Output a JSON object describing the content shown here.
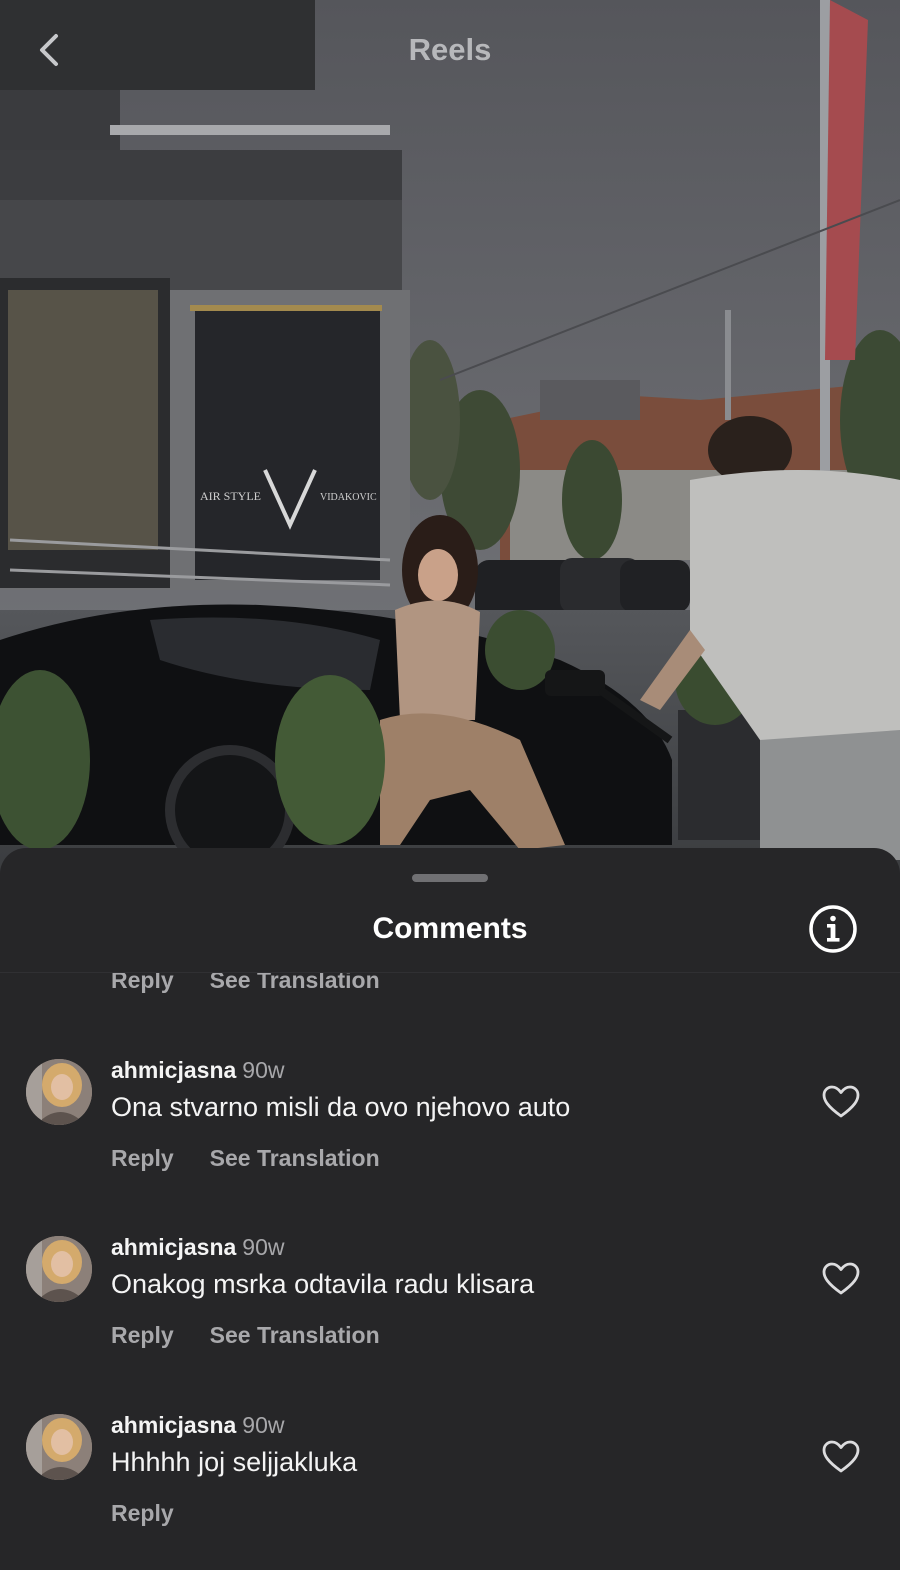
{
  "topbar": {
    "title": "Reels",
    "back_icon": "chevron-left-icon"
  },
  "comments_sheet": {
    "title": "Comments",
    "info_icon": "info-icon",
    "partial_actions": {
      "reply": "Reply",
      "translate": "See Translation"
    },
    "comments": [
      {
        "username": "ahmicjasna",
        "time": "90w",
        "text": "Ona stvarno misli da ovo njehovo auto",
        "reply": "Reply",
        "translate": "See Translation"
      },
      {
        "username": "ahmicjasna",
        "time": "90w",
        "text": "Onakog msrka odtavila radu klisara",
        "reply": "Reply",
        "translate": "See Translation"
      },
      {
        "username": "ahmicjasna",
        "time": "90w",
        "text": "Hhhhh joj seljjakluka",
        "reply": "Reply",
        "translate": ""
      }
    ]
  },
  "colors": {
    "sheet_bg": "#262628",
    "primary_text": "#f4f4f4",
    "secondary_text": "#a8a8ab"
  }
}
